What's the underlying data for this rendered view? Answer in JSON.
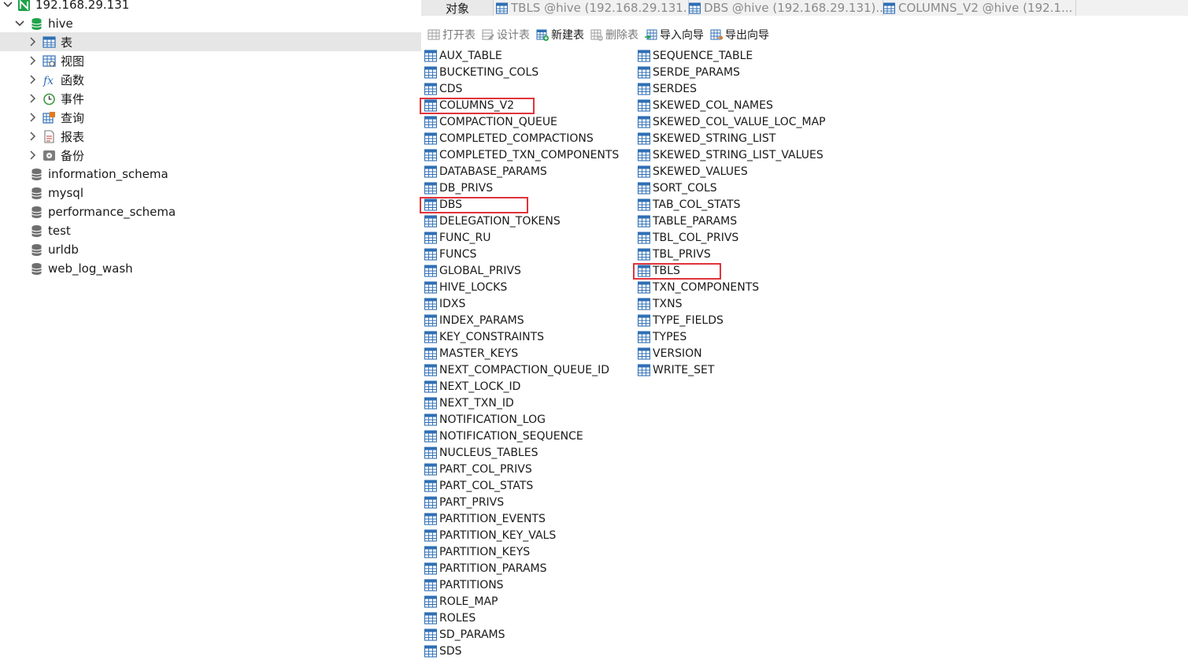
{
  "navigator": {
    "connection": "192.168.29.131",
    "database": "hive",
    "categories": [
      {
        "label": "表",
        "icon": "table-icon"
      },
      {
        "label": "视图",
        "icon": "view-icon"
      },
      {
        "label": "函数",
        "icon": "function-icon"
      },
      {
        "label": "事件",
        "icon": "event-icon"
      },
      {
        "label": "查询",
        "icon": "query-icon"
      },
      {
        "label": "报表",
        "icon": "report-icon"
      },
      {
        "label": "备份",
        "icon": "backup-icon"
      }
    ],
    "other_databases": [
      "information_schema",
      "mysql",
      "performance_schema",
      "test",
      "urldb",
      "web_log_wash"
    ]
  },
  "tabs": {
    "objects": "对象",
    "open": [
      "TBLS @hive (192.168.29.131...",
      "DBS @hive (192.168.29.131)...",
      "COLUMNS_V2 @hive (192.1..."
    ]
  },
  "toolbar": {
    "open_table": "打开表",
    "design_table": "设计表",
    "new_table": "新建表",
    "delete_table": "删除表",
    "import_wizard": "导入向导",
    "export_wizard": "导出向导"
  },
  "tables": {
    "column1": [
      "AUX_TABLE",
      "BUCKETING_COLS",
      "CDS",
      "COLUMNS_V2",
      "COMPACTION_QUEUE",
      "COMPLETED_COMPACTIONS",
      "COMPLETED_TXN_COMPONENTS",
      "DATABASE_PARAMS",
      "DB_PRIVS",
      "DBS",
      "DELEGATION_TOKENS",
      "FUNC_RU",
      "FUNCS",
      "GLOBAL_PRIVS",
      "HIVE_LOCKS",
      "IDXS",
      "INDEX_PARAMS",
      "KEY_CONSTRAINTS",
      "MASTER_KEYS",
      "NEXT_COMPACTION_QUEUE_ID",
      "NEXT_LOCK_ID",
      "NEXT_TXN_ID",
      "NOTIFICATION_LOG",
      "NOTIFICATION_SEQUENCE",
      "NUCLEUS_TABLES",
      "PART_COL_PRIVS",
      "PART_COL_STATS",
      "PART_PRIVS",
      "PARTITION_EVENTS",
      "PARTITION_KEY_VALS",
      "PARTITION_KEYS",
      "PARTITION_PARAMS",
      "PARTITIONS",
      "ROLE_MAP",
      "ROLES",
      "SD_PARAMS",
      "SDS"
    ],
    "column2": [
      "SEQUENCE_TABLE",
      "SERDE_PARAMS",
      "SERDES",
      "SKEWED_COL_NAMES",
      "SKEWED_COL_VALUE_LOC_MAP",
      "SKEWED_STRING_LIST",
      "SKEWED_STRING_LIST_VALUES",
      "SKEWED_VALUES",
      "SORT_COLS",
      "TAB_COL_STATS",
      "TABLE_PARAMS",
      "TBL_COL_PRIVS",
      "TBL_PRIVS",
      "TBLS",
      "TXN_COMPONENTS",
      "TXNS",
      "TYPE_FIELDS",
      "TYPES",
      "VERSION",
      "WRITE_SET"
    ],
    "highlighted": [
      "COLUMNS_V2",
      "DBS",
      "TBLS"
    ]
  },
  "colors": {
    "highlight_box": "#e0333b",
    "table_icon": "#2f6fb5",
    "database_icon": "#1fa34a",
    "selected_row": "#e6e6e6"
  }
}
